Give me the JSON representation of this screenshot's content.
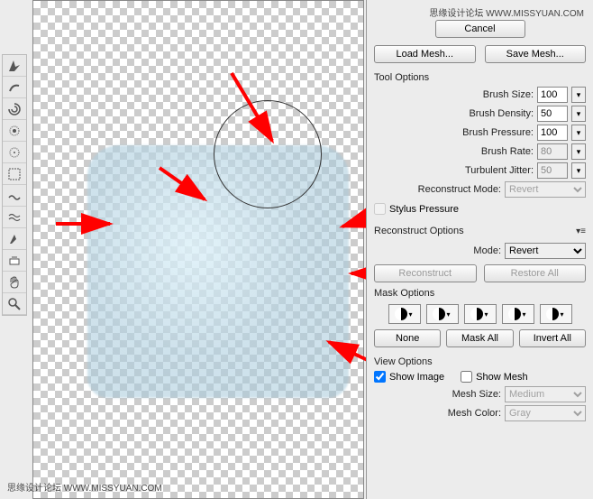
{
  "watermark": "思缘设计论坛  WWW.MISSYUAN.COM",
  "cancel": "Cancel",
  "loadMesh": "Load Mesh...",
  "saveMesh": "Save Mesh...",
  "toolOptions": {
    "title": "Tool Options",
    "brushSize": {
      "label": "Brush Size:",
      "value": "100"
    },
    "brushDensity": {
      "label": "Brush Density:",
      "value": "50"
    },
    "brushPressure": {
      "label": "Brush Pressure:",
      "value": "100"
    },
    "brushRate": {
      "label": "Brush Rate:",
      "value": "80"
    },
    "turbulentJitter": {
      "label": "Turbulent Jitter:",
      "value": "50"
    },
    "reconstructMode": {
      "label": "Reconstruct Mode:",
      "value": "Revert"
    },
    "stylusPressure": "Stylus Pressure"
  },
  "reconstruct": {
    "title": "Reconstruct Options",
    "modeLabel": "Mode:",
    "mode": "Revert",
    "reconstructBtn": "Reconstruct",
    "restoreBtn": "Restore All"
  },
  "mask": {
    "title": "Mask Options",
    "none": "None",
    "maskAll": "Mask All",
    "invertAll": "Invert All"
  },
  "view": {
    "title": "View Options",
    "showImage": "Show Image",
    "showMesh": "Show Mesh",
    "meshSizeLabel": "Mesh Size:",
    "meshSize": "Medium",
    "meshColorLabel": "Mesh Color:",
    "meshColor": "Gray"
  }
}
